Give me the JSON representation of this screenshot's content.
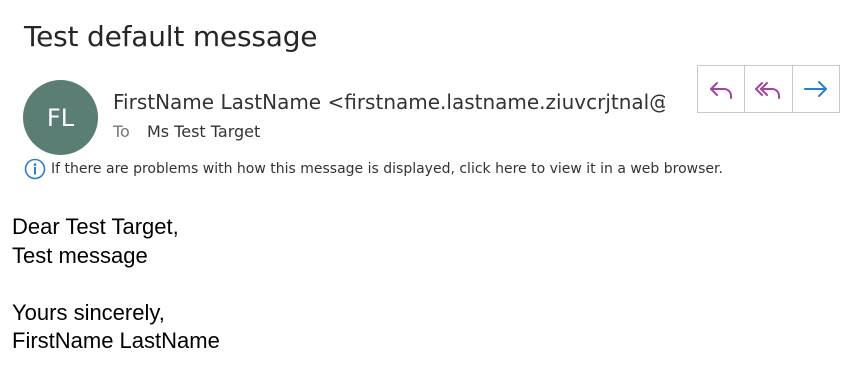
{
  "email": {
    "subject": "Test default message",
    "avatar_initials": "FL",
    "sender": "FirstName LastName <firstname.lastname.ziuvcrjtnal@carrier.example.com>",
    "to_label": "To",
    "to_value": "Ms Test Target",
    "info_message": "If there are problems with how this message is displayed, click here to view it in a web browser.",
    "body_lines": [
      "Dear Test Target,",
      "Test message",
      "",
      "Yours sincerely,",
      "FirstName LastName"
    ]
  },
  "actions": [
    {
      "name": "reply-icon",
      "color": "#a4449c"
    },
    {
      "name": "reply-all-icon",
      "color": "#a4449c"
    },
    {
      "name": "forward-icon",
      "color": "#2b7cd3"
    }
  ],
  "colors": {
    "avatar_bg": "#5a7d74",
    "info_icon": "#2b7cd3",
    "reply_accent": "#a4449c",
    "forward_accent": "#2b7cd3"
  }
}
